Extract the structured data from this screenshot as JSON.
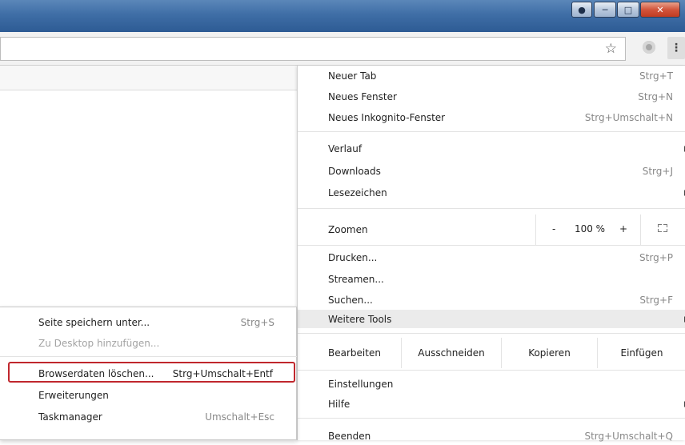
{
  "menu": {
    "new_tab": {
      "label": "Neuer Tab",
      "shortcut": "Strg+T"
    },
    "new_window": {
      "label": "Neues Fenster",
      "shortcut": "Strg+N"
    },
    "new_incognito": {
      "label": "Neues Inkognito-Fenster",
      "shortcut": "Strg+Umschalt+N"
    },
    "history": {
      "label": "Verlauf"
    },
    "downloads": {
      "label": "Downloads",
      "shortcut": "Strg+J"
    },
    "bookmarks": {
      "label": "Lesezeichen"
    },
    "zoom": {
      "label": "Zoomen",
      "minus": "-",
      "value": "100 %",
      "plus": "+"
    },
    "print": {
      "label": "Drucken...",
      "shortcut": "Strg+P"
    },
    "cast": {
      "label": "Streamen..."
    },
    "find": {
      "label": "Suchen...",
      "shortcut": "Strg+F"
    },
    "more_tools": {
      "label": "Weitere Tools"
    },
    "edit": {
      "label": "Bearbeiten",
      "cut": "Ausschneiden",
      "copy": "Kopieren",
      "paste": "Einfügen"
    },
    "settings": {
      "label": "Einstellungen"
    },
    "help": {
      "label": "Hilfe"
    },
    "exit": {
      "label": "Beenden",
      "shortcut": "Strg+Umschalt+Q"
    }
  },
  "submenu": {
    "save_page": {
      "label": "Seite speichern unter...",
      "shortcut": "Strg+S"
    },
    "add_to_desktop": {
      "label": "Zu Desktop hinzufügen..."
    },
    "clear_data": {
      "label": "Browserdaten löschen...",
      "shortcut": "Strg+Umschalt+Entf"
    },
    "extensions": {
      "label": "Erweiterungen"
    },
    "task_manager": {
      "label": "Taskmanager",
      "shortcut": "Umschalt+Esc"
    }
  },
  "colors": {
    "highlight_border": "#c0272d",
    "titlebar": "#3f6ea6"
  }
}
